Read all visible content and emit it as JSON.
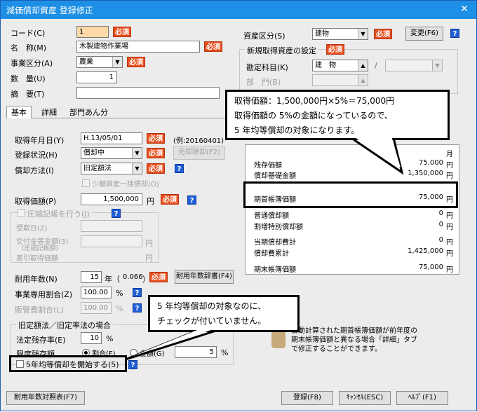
{
  "title": "減価償却資産 登録修正",
  "code": {
    "label": "コード(C)",
    "value": "1"
  },
  "name": {
    "label": "名　称(M)",
    "value": "木製建物作業場"
  },
  "business": {
    "label": "事業区分(A)",
    "value": "農業"
  },
  "qty": {
    "label": "数　量(U)",
    "value": "1"
  },
  "summary": {
    "label": "摘　要(T)",
    "value": ""
  },
  "required": "必須",
  "help": "?",
  "asset_class": {
    "label": "資産区分(S)",
    "value": "建物",
    "change": "変更(F6)"
  },
  "new_acq": {
    "label": "新規取得資産の設定",
    "account_label": "勘定科目(K)",
    "account_value": "建　物",
    "dept_label": "部　門(B)",
    "slash": "/"
  },
  "tabs": [
    "基本",
    "詳細",
    "部門あん分"
  ],
  "acq_date": {
    "label": "取得年月日(Y)",
    "value": "H.13/05/01",
    "example": "(例:20160401)"
  },
  "reg_status": {
    "label": "登録状況(H)",
    "value": "償却中",
    "disposal": "売却除却(F2)"
  },
  "dep_method": {
    "label": "償却方法(I)",
    "value": "旧定額法"
  },
  "lump_sum": "少額資産一括償却(O)",
  "acq_price": {
    "label": "取得価額(P)",
    "value": "1,500,000",
    "unit": "円"
  },
  "compress": {
    "label": "圧縮記帳を行う(J)",
    "date_label": "受取日(Z)",
    "amount_label": "交付金等金額(3)",
    "amount_sub": "(圧縮記帳額)",
    "diff_label": "差引取得価額",
    "yen": "円"
  },
  "useful_life": {
    "label": "耐用年数(N)",
    "value": "15",
    "unit": "年（",
    "rate": "0.066",
    "close": "）",
    "dict_btn": "耐用年数辞書(F4)"
  },
  "business_ratio": {
    "label": "事業専用割合(Z)",
    "value": "100.00",
    "unit": "%"
  },
  "special_ratio": {
    "label": "販管費割合(L)",
    "value": "100.00",
    "unit": "%"
  },
  "old_method": {
    "label": "旧定額法／旧定率法の場合",
    "residual_label": "法定残存率(E)",
    "residual_value": "10",
    "residual_unit": "%",
    "limit_label": "限度残存額",
    "radio1": "割合(F)",
    "radio2": "金額(G)",
    "limit_value": "5",
    "limit_unit": "%"
  },
  "five_year": "5年均等償却を開始する(5)",
  "right_panel": {
    "year_col": "月",
    "rows": [
      {
        "k": "残存価額",
        "v": "75,000",
        "u": "円"
      },
      {
        "k": "償却基礎金額",
        "v": "1,350,000",
        "u": "円"
      },
      {
        "k": "期首帳簿価額",
        "v": "75,000",
        "u": "円"
      },
      {
        "k": "普通償却額",
        "v": "0",
        "u": "円"
      },
      {
        "k": "割増特別償却額",
        "v": "0",
        "u": "円"
      },
      {
        "k": "当期償却費計",
        "v": "0",
        "u": "円"
      },
      {
        "k": "償却費累計",
        "v": "1,425,000",
        "u": "円"
      },
      {
        "k": "期末帳簿価額",
        "v": "75,000",
        "u": "円"
      }
    ]
  },
  "info_text": [
    "自動計算された期首帳簿価額が前年度の",
    "期末帳簿価額と異なる場合「詳細」タブ",
    "で修正することができます。"
  ],
  "buttons": {
    "table": "耐用年数対照表(F7)",
    "register": "登録(F8)",
    "cancel": "ｷｬﾝｾﾙ(ESC)",
    "help": "ﾍﾙﾌﾟ(F1)"
  },
  "callout1": [
    "取得価額：1,500,000円×5%＝75,000円",
    "取得価額の 5%の金額になっているので、",
    "5 年均等償却の対象になります。"
  ],
  "callout2": [
    "5 年均等償却の対象なのに、",
    "チェックが付いていません。"
  ]
}
